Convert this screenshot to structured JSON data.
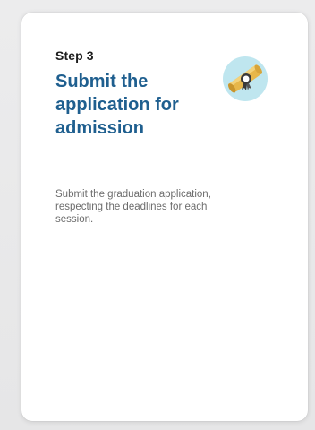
{
  "card": {
    "step_label": "Step 3",
    "title": "Submit the application for admission",
    "description": "Submit the graduation application, respecting the deadlines for each session.",
    "icon": "diploma-icon",
    "colors": {
      "title": "#1f5f8f",
      "icon_bg": "#bfe6ef",
      "scroll": "#e7b74a"
    }
  }
}
